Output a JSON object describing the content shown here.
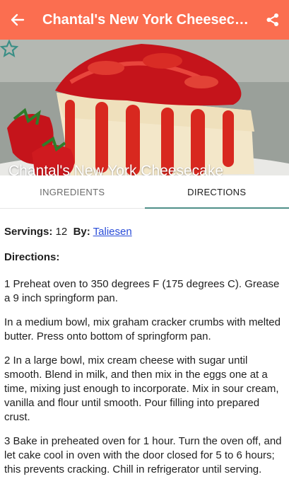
{
  "colors": {
    "appbar": "#fb6e50",
    "tab_indicator": "#4f8f88",
    "link": "#2a4dd8"
  },
  "appbar": {
    "back_icon": "arrow-left-icon",
    "title": "Chantal's New York Cheeseca...",
    "share_icon": "share-icon"
  },
  "hero": {
    "title": "Chantal's New York Cheesecake",
    "star_icon": "star-outline-icon"
  },
  "tabs": [
    {
      "label": "INGREDIENTS",
      "active": false
    },
    {
      "label": "DIRECTIONS",
      "active": true
    }
  ],
  "recipe": {
    "servings_label": "Servings:",
    "servings_value": "12",
    "by_label": "By:",
    "author": "Taliesen",
    "directions_heading": "Directions:",
    "steps": [
      "1 Preheat oven to 350 degrees F (175 degrees C). Grease a 9 inch springform pan.",
      "In a medium bowl, mix graham cracker crumbs with melted butter. Press onto bottom of springform pan.",
      "2 In a large bowl, mix cream cheese with sugar until smooth. Blend in milk, and then mix in the eggs one at a time, mixing just enough to incorporate. Mix in sour cream, vanilla and flour until smooth. Pour filling into prepared crust.",
      "3 Bake in preheated oven for 1 hour. Turn the oven off, and let cake cool in oven with the door closed for 5 to 6 hours; this prevents cracking. Chill in refrigerator until serving."
    ]
  }
}
